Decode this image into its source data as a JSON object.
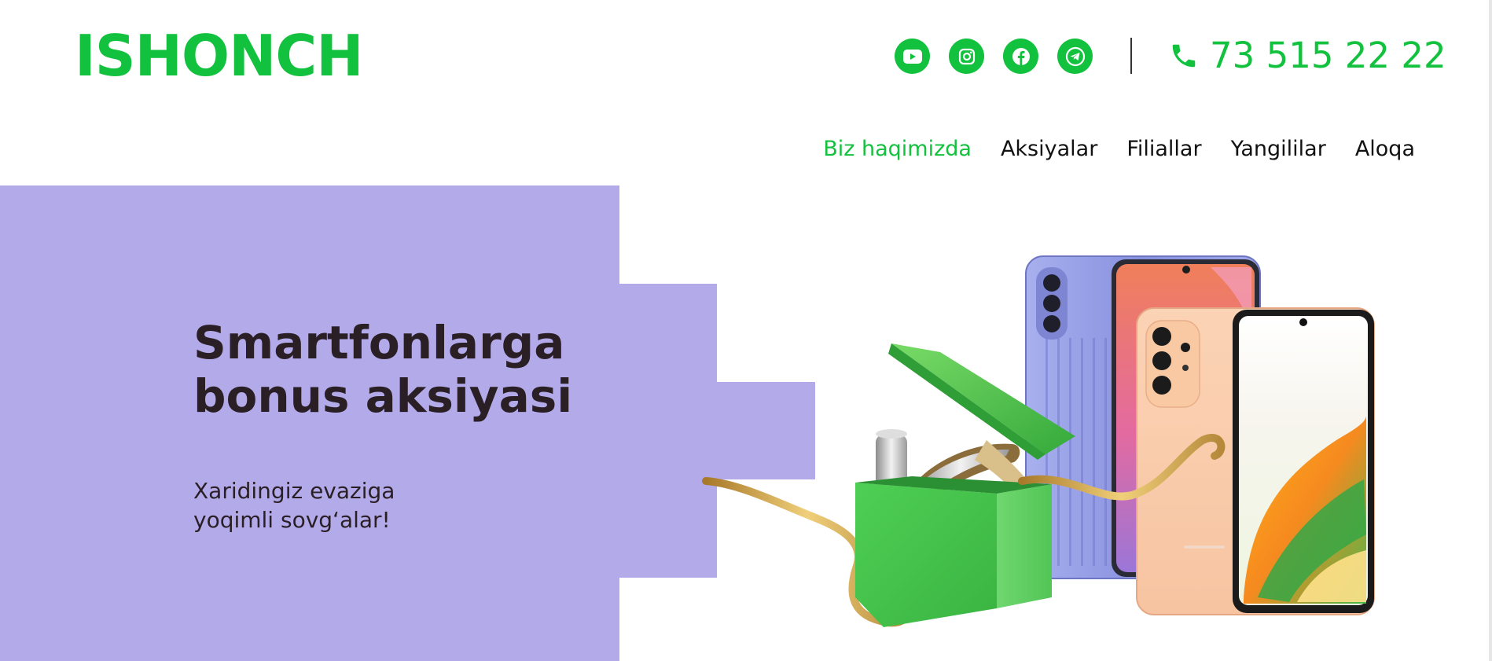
{
  "header": {
    "logo": "ISHONCH",
    "phone": "73 515 22 22",
    "social_icons": [
      "youtube-icon",
      "instagram-icon",
      "facebook-icon",
      "telegram-icon"
    ]
  },
  "nav": {
    "items": [
      {
        "label": "Biz haqimizda",
        "active": true
      },
      {
        "label": "Aksiyalar",
        "active": false
      },
      {
        "label": "Filiallar",
        "active": false
      },
      {
        "label": "Yangililar",
        "active": false
      },
      {
        "label": "Aloqa",
        "active": false
      }
    ]
  },
  "banner": {
    "headline": "Smartfonlarga bonus aksiyasi",
    "subtext": "Xaridingiz evaziga yoqimli sovg‘alar!"
  },
  "colors": {
    "brand": "#12c13d",
    "banner_bg": "#b3aaea",
    "text_dark": "#2a1f25"
  }
}
